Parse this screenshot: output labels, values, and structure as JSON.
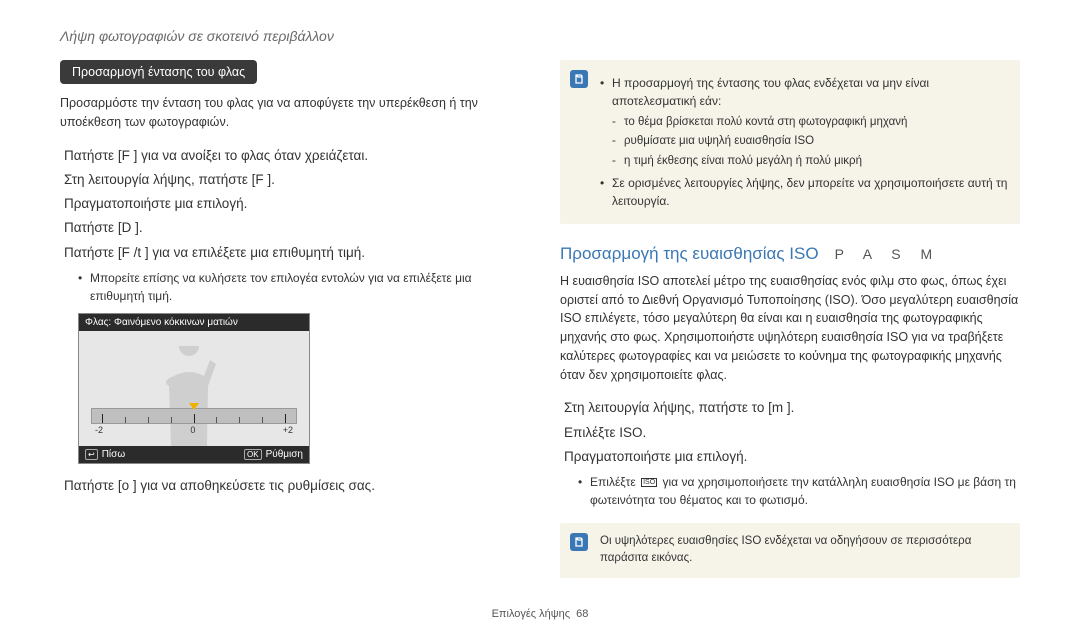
{
  "header": "Λήψη φωτογραφιών σε σκοτεινό περιβάλλον",
  "left": {
    "pill": "Προσαρμογή έντασης του φλας",
    "intro": "Προσαρμόστε την ένταση του φλας για να αποφύγετε την υπερέκθεση ή την υποέκθεση των φωτογραφιών.",
    "s1": "Πατήστε [F   ] για να ανοίξει το φλας όταν χρειάζεται.",
    "s2": "Στη λειτουργία λήψης, πατήστε [F   ].",
    "s3": "Πραγματοποιήστε μια επιλογή.",
    "s4": "Πατήστε [D       ].",
    "s5": "Πατήστε [F  /t   ] για να επιλέξετε μια επιθυμητή τιμή.",
    "s5_bullet": "Μπορείτε επίσης να κυλήσετε τον επιλογέα εντολών για να επιλέξετε μια επιθυμητή τιμή.",
    "s6": "Πατήστε [o    ] για να αποθηκεύσετε τις ρυθμίσεις σας.",
    "screenshot": {
      "title": "Φλας: Φαινόμενο κόκκινων ματιών",
      "labels": [
        "-2",
        "0",
        "+2"
      ],
      "back_icon": "↩",
      "back": "Πίσω",
      "ok": "OK",
      "adjust": "Ρύθμιση"
    }
  },
  "right": {
    "note1": {
      "b1": "Η προσαρμογή της έντασης του φλας ενδέχεται να μην είναι αποτελεσματική εάν:",
      "sb1": "το θέμα βρίσκεται πολύ κοντά στη φωτογραφική μηχανή",
      "sb2": "ρυθμίσατε μια υψηλή ευαισθησία ISO",
      "sb3": "η τιμή έκθεσης είναι πολύ μεγάλη ή πολύ μικρή",
      "b2": "Σε ορισμένες λειτουργίες λήψης, δεν μπορείτε να χρησιμοποιήσετε αυτή τη λειτουργία."
    },
    "section_title": "Προσαρμογή της ευαισθησίας ISO",
    "modes": "P A S M",
    "body": "Η ευαισθησία ISO αποτελεί μέτρο της ευαισθησίας ενός φιλμ στο φως, όπως έχει οριστεί από το Διεθνή Οργανισμό Τυποποίησης (ISO). Όσο μεγαλύτερη ευαισθησία ISO επιλέγετε, τόσο μεγαλύτερη θα είναι και η ευαισθησία της φωτογραφικής μηχανής στο φως. Χρησιμοποιήστε υψηλότερη ευαισθησία ISO για να τραβήξετε καλύτερες φωτογραφίες και να μειώσετε το κούνημα της φωτογραφικής μηχανής όταν δεν χρησιμοποιείτε φλας.",
    "r1": "Στη λειτουργία λήψης, πατήστε το [m        ].",
    "r2": "Επιλέξτε ISO.",
    "r3": "Πραγματοποιήστε μια επιλογή.",
    "r_bullet_a": "Επιλέξτε ",
    "r_bullet_icon": "ISO",
    "r_bullet_b": " για να χρησιμοποιήσετε την κατάλληλη ευαισθησία ISO με βάση τη φωτεινότητα του θέματος και το φωτισμό.",
    "note2": "Οι υψηλότερες ευαισθησίες ISO ενδέχεται να οδηγήσουν σε περισσότερα παράσιτα εικόνας."
  },
  "footer": {
    "label": "Επιλογές λήψης",
    "page": "68"
  }
}
